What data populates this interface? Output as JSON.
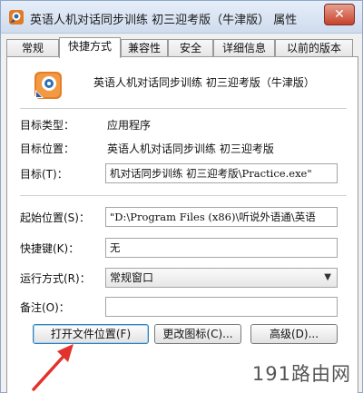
{
  "window": {
    "title": "英语人机对话同步训练 初三迎考版（牛津版） 属性",
    "close_label": "✕"
  },
  "tabs": [
    {
      "label": "常规"
    },
    {
      "label": "快捷方式"
    },
    {
      "label": "兼容性"
    },
    {
      "label": "安全"
    },
    {
      "label": "详细信息"
    },
    {
      "label": "以前的版本"
    }
  ],
  "active_tab": "快捷方式",
  "shortcut": {
    "name": "英语人机对话同步训练 初三迎考版（牛津版）",
    "target_type_label": "目标类型：",
    "target_type_value": "应用程序",
    "target_location_label": "目标位置：",
    "target_location_value": "英语人机对话同步训练 初三迎考版",
    "target_label": "目标(T)：",
    "target_value": "机对话同步训练 初三迎考版\\Practice.exe\"",
    "start_in_label": "起始位置(S)：",
    "start_in_value": "\"D:\\Program Files (x86)\\听说外语通\\英语",
    "shortcut_key_label": "快捷键(K)：",
    "shortcut_key_value": "无",
    "run_label": "运行方式(R)：",
    "run_value": "常规窗口",
    "comment_label": "备注(O)：",
    "comment_value": ""
  },
  "buttons": {
    "open_location": "打开文件位置(F)",
    "change_icon": "更改图标(C)...",
    "advanced": "高级(D)..."
  },
  "watermark": "191路由网",
  "colors": {
    "annotation_arrow": "#e3322b",
    "title_bar": "#dbe6f4"
  }
}
